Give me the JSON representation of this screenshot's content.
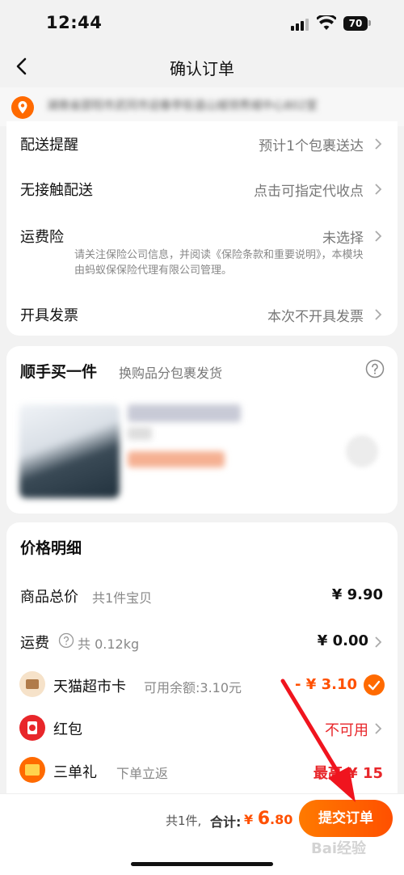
{
  "status_bar": {
    "time": "12:44",
    "battery": "70"
  },
  "nav": {
    "title": "确认订单"
  },
  "address": {
    "text": "湖南省邵阳市武冈市迎春亭街道山城领秀城中心802室"
  },
  "delivery": {
    "rows": [
      {
        "label": "配送提醒",
        "value": "预计1个包裹送达"
      },
      {
        "label": "无接触配送",
        "value": "点击可指定代收点"
      },
      {
        "label": "运费险",
        "value": "未选择"
      },
      {
        "label": "开具发票",
        "value": "本次不开具发票"
      }
    ],
    "insurance_note": "请关注保险公司信息，并阅读《保险条款和重要说明》，本模块由蚂蚁保保险代理有限公司管理。"
  },
  "addon": {
    "title": "顺手买一件",
    "subtitle": "换购品分包裹发货"
  },
  "price": {
    "title": "价格明细",
    "goods_label": "商品总价",
    "goods_sub": "共1件宝贝",
    "goods_value": "¥ 9.90",
    "shipping_label": "运费",
    "shipping_sub": "共 0.12kg",
    "shipping_value": "¥ 0.00",
    "card_label": "天猫超市卡",
    "card_sub": "可用余额:3.10元",
    "card_value": "- ¥ 3.10",
    "redpack_label": "红包",
    "redpack_value": "不可用",
    "gift_label": "三单礼",
    "gift_sub": "下单立返",
    "gift_value": "最高 ¥ 15"
  },
  "bottom": {
    "count": "共1件,",
    "total_label": "合计:",
    "total_symbol": "¥",
    "total_int": "6",
    "total_dec": ".80",
    "submit": "提交订单"
  },
  "watermark": "Bai经验",
  "colors": {
    "accent": "#ff5000",
    "brand_orange": "#ff7a00",
    "red": "#e8262a"
  }
}
